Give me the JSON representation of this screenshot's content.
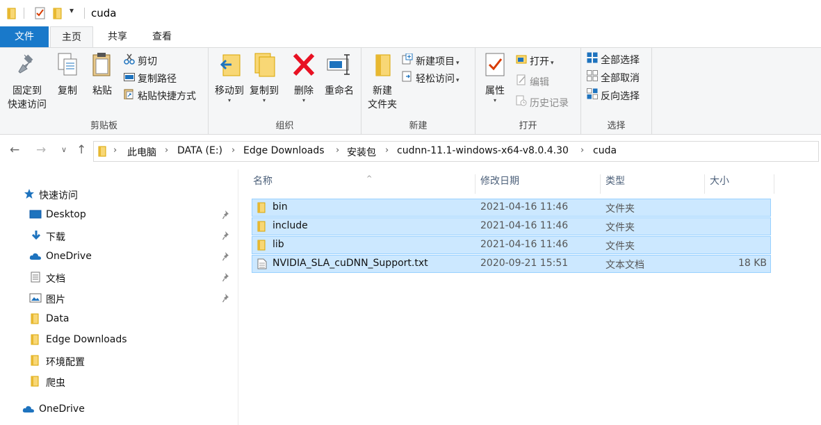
{
  "window": {
    "title": "cuda"
  },
  "ribbon_tabs": [
    "文件",
    "主页",
    "共享",
    "查看"
  ],
  "ribbon": {
    "clipboard": {
      "pin_quick_access": [
        "固定到",
        "快速访问"
      ],
      "copy": "复制",
      "paste": "粘贴",
      "cut": "剪切",
      "copy_path": "复制路径",
      "paste_shortcut": "粘贴快捷方式",
      "label": "剪贴板"
    },
    "organize": {
      "move_to": "移动到",
      "copy_to": "复制到",
      "delete": "删除",
      "rename": "重命名",
      "label": "组织"
    },
    "new": {
      "new_folder": [
        "新建",
        "文件夹"
      ],
      "new_item": "新建项目",
      "easy_access": "轻松访问",
      "label": "新建"
    },
    "open": {
      "properties": "属性",
      "open": "打开",
      "edit": "编辑",
      "history": "历史记录",
      "label": "打开"
    },
    "select": {
      "select_all": "全部选择",
      "select_none": "全部取消",
      "invert": "反向选择",
      "label": "选择"
    }
  },
  "breadcrumb": [
    "此电脑",
    "DATA (E:)",
    "Edge Downloads",
    "安装包",
    "cudnn-11.1-windows-x64-v8.0.4.30",
    "cuda"
  ],
  "sidebar": {
    "quick_access": "快速访问",
    "items": [
      {
        "label": "Desktop",
        "icon": "desktop-icon",
        "pinned": true
      },
      {
        "label": "下载",
        "icon": "download-icon",
        "pinned": true
      },
      {
        "label": "OneDrive",
        "icon": "onedrive-icon",
        "pinned": true
      },
      {
        "label": "文档",
        "icon": "documents-icon",
        "pinned": true
      },
      {
        "label": "图片",
        "icon": "pictures-icon",
        "pinned": true
      },
      {
        "label": "Data",
        "icon": "folder-icon",
        "pinned": false
      },
      {
        "label": "Edge Downloads",
        "icon": "folder-icon",
        "pinned": false
      },
      {
        "label": "环境配置",
        "icon": "folder-icon",
        "pinned": false
      },
      {
        "label": "爬虫",
        "icon": "folder-icon",
        "pinned": false
      }
    ],
    "onedrive_root": "OneDrive"
  },
  "columns": {
    "name": "名称",
    "date": "修改日期",
    "type": "类型",
    "size": "大小"
  },
  "files": [
    {
      "name": "bin",
      "date": "2021-04-16 11:46",
      "type": "文件夹",
      "size": "",
      "icon": "folder-icon",
      "selected": true
    },
    {
      "name": "include",
      "date": "2021-04-16 11:46",
      "type": "文件夹",
      "size": "",
      "icon": "folder-icon",
      "selected": true
    },
    {
      "name": "lib",
      "date": "2021-04-16 11:46",
      "type": "文件夹",
      "size": "",
      "icon": "folder-icon",
      "selected": true
    },
    {
      "name": "NVIDIA_SLA_cuDNN_Support.txt",
      "date": "2020-09-21 15:51",
      "type": "文本文档",
      "size": "18 KB",
      "icon": "text-file-icon",
      "selected": true
    }
  ],
  "colors": {
    "file_tab": "#1979ca",
    "selection_bg": "#cce8ff",
    "selection_border": "#99d1ff",
    "folder_yellow": "#f8d775",
    "delete_red": "#e81123"
  }
}
